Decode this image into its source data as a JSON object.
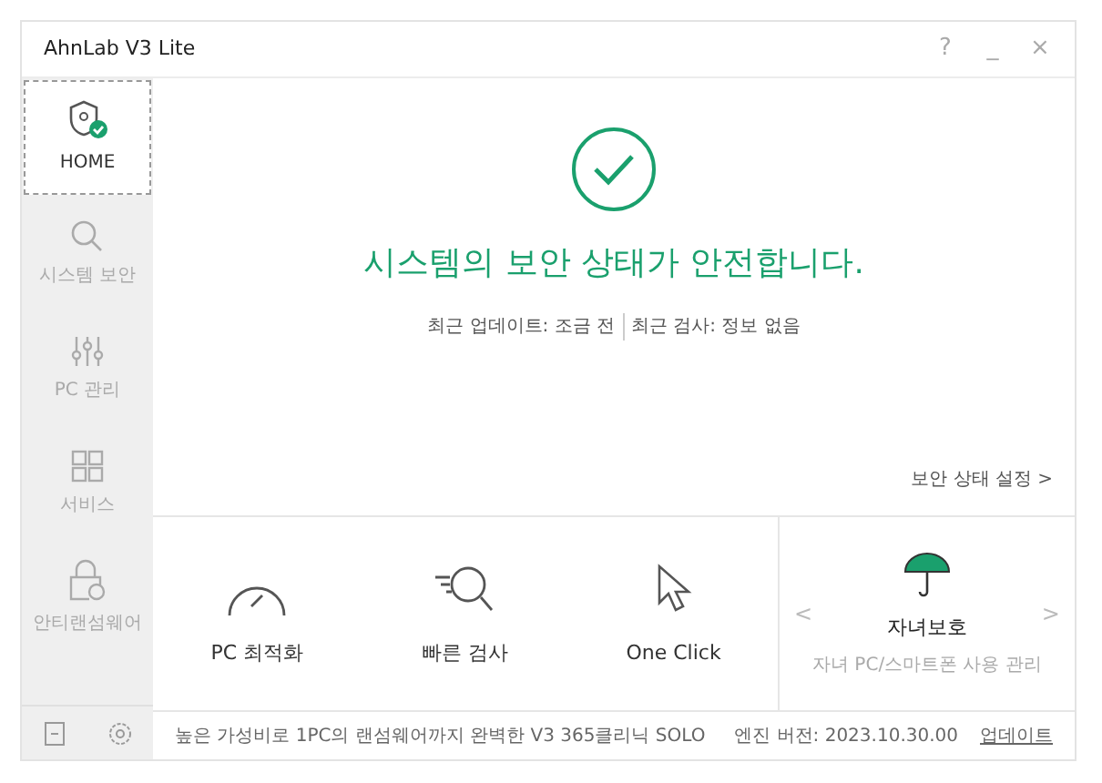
{
  "window": {
    "title": "AhnLab V3 Lite",
    "controls": [
      "?",
      "_",
      "×"
    ]
  },
  "sidebar": {
    "items": [
      {
        "label": "HOME",
        "kind": "home",
        "selected": true
      },
      {
        "label": "시스템 보안",
        "kind": "search",
        "selected": false
      },
      {
        "label": "PC 관리",
        "kind": "sliders",
        "selected": false
      },
      {
        "label": "서비스",
        "kind": "grid",
        "selected": false
      },
      {
        "label": "안티랜섬웨어",
        "kind": "lock",
        "selected": false
      }
    ]
  },
  "status": {
    "headline": "시스템의 보안 상태가 안전합니다.",
    "details": [
      "최근 업데이트: 조금 전",
      "최근 검사: 정보 없음"
    ],
    "settings_link": "보안 상태 설정 >"
  },
  "tiles": [
    {
      "label": "PC 최적화",
      "kind": "gauge"
    },
    {
      "label": "빠른 검사",
      "kind": "scan"
    },
    {
      "label": "One Click",
      "kind": "cursor"
    }
  ],
  "promo": {
    "title": "자녀보호",
    "subtitle": "자녀 PC/스마트폰 사용 관리",
    "prev": "<",
    "next": ">"
  },
  "footer": {
    "ad": "높은 가성비로 1PC의 랜섬웨어까지 완벽한 V3 365클리닉 SOLO",
    "engine": "엔진 버전: 2023.10.30.00",
    "update": "업데이트"
  }
}
